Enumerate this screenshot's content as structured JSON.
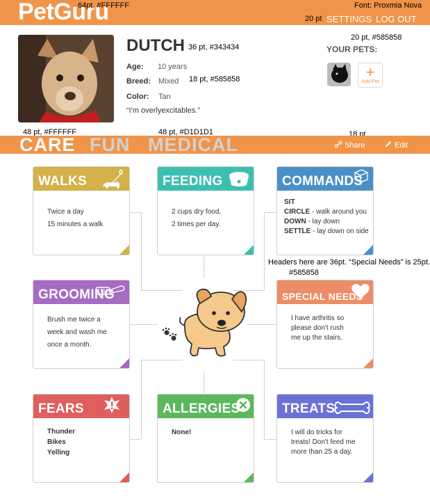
{
  "header": {
    "logo": "PetGuru",
    "annotation_logo": "64pt, #FFFFFF",
    "annotation_font": "Font: Proxmia Nova",
    "annotation_nav": "20 pt",
    "settings_label": "SETTINGS",
    "logout_label": "LOG OUT"
  },
  "profile": {
    "name": "DUTCH",
    "annotation_name": "36 pt, #343434",
    "age_label": "Age:",
    "age_value": "10 years",
    "breed_label": "Breed:",
    "breed_value": "Mixed",
    "annotation_breed": "18 pt, #585858",
    "color_label": "Color:",
    "color_value": "Tan",
    "quote": "“I'm overlyexcitables.”"
  },
  "your_pets": {
    "annotation": "20 pt, #585858",
    "title": "YOUR PETS:",
    "add_label": "Add Pet"
  },
  "tabs": {
    "annotation_active": "48 pt, #FFFFFF",
    "annotation_inactive": "48 pt, #D1D1D1",
    "annotation_actions": "18 pt",
    "items": [
      "CARE",
      "FUN",
      "MEDICAL"
    ],
    "share_label": "Share",
    "edit_label": "Edit",
    "active_color": "#FFFFFF",
    "inactive_color": "#D1D1D1"
  },
  "cards": {
    "walks": {
      "title": "WALKS",
      "color": "#D4B14A",
      "lines": [
        "Twice a day",
        "15 minutes a walk"
      ]
    },
    "feeding": {
      "title": "FEEDING",
      "color": "#3DBFB0",
      "lines": [
        "2 cups dry food,",
        "2 times per day."
      ]
    },
    "commands": {
      "title": "COMMANDS",
      "color": "#4A90C8",
      "items": [
        {
          "key": "SIT",
          "desc": ""
        },
        {
          "key": "CIRCLE",
          "desc": " - walk around you"
        },
        {
          "key": "DOWN",
          "desc": " - lay down"
        },
        {
          "key": "SETTLE",
          "desc": " - lay down on side"
        }
      ]
    },
    "grooming": {
      "title": "GROOMING",
      "color": "#A66BC2",
      "lines": [
        "Brush me twice a",
        "week and wash me",
        "once a month."
      ]
    },
    "special_needs": {
      "title": "SPECIAL NEEDS",
      "color": "#EC8D68",
      "lines": [
        "I have arthritis so",
        "please don't rush",
        "me up the stairs."
      ]
    },
    "fears": {
      "title": "FEARS",
      "color": "#E05E5E",
      "lines": [
        "Thunder",
        "Bikes",
        "Yelling"
      ]
    },
    "allergies": {
      "title": "ALLERGIES",
      "color": "#5BB85D",
      "lines": [
        "None!"
      ]
    },
    "treats": {
      "title": "TREATS",
      "color": "#6A72D6",
      "lines": [
        "I will do tricks for",
        "treats! Don't feed me",
        "more than 25 a day."
      ]
    }
  },
  "annotations": {
    "headers_note": "Headers here are 36pt. “Special Needs” is 25pt.",
    "headers_color": "#585858"
  },
  "icons": [
    "leash-icon",
    "food-bowl-icon",
    "box-icon",
    "brush-icon",
    "heart-icon",
    "alert-icon",
    "close-circle-icon",
    "bone-icon",
    "share-icon",
    "pencil-icon",
    "dog-icon",
    "paw-prints-icon"
  ]
}
